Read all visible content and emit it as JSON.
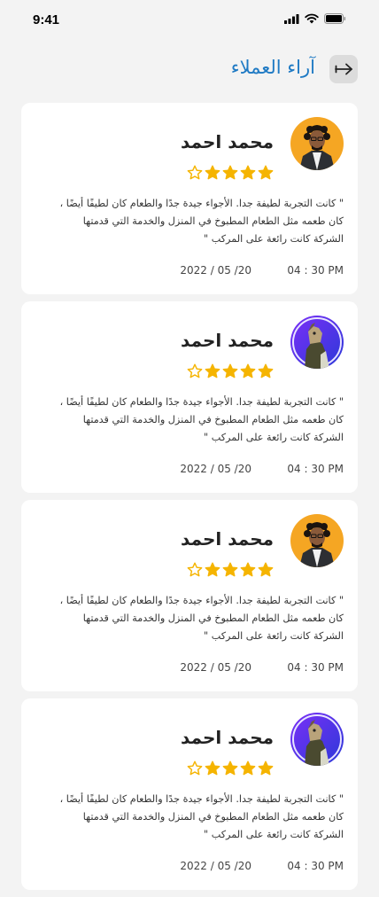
{
  "status_bar": {
    "time": "9:41"
  },
  "header": {
    "title": "آراء العملاء"
  },
  "colors": {
    "accent": "#1f7ac4",
    "star": "#f5b400",
    "background": "#f3f3f3",
    "card": "#ffffff"
  },
  "reviews": [
    {
      "name": "محمد احمد",
      "avatar": "orange-man-avatar",
      "rating": 4,
      "max_rating": 5,
      "text": "\" كانت التجربة لطيفة جدا. الأجواء جيدة جدًا والطعام كان لطيفًا أيضًا ، كان طعمه مثل الطعام المطبوخ في المنزل والخدمة التي قدمتها الشركة كانت رائعة على المركب \"",
      "time": "04 : 30 PM",
      "date": "2022 / 05 /20"
    },
    {
      "name": "محمد احمد",
      "avatar": "purple-horse-avatar",
      "rating": 4,
      "max_rating": 5,
      "text": "\" كانت التجربة لطيفة جدا. الأجواء جيدة جدًا والطعام كان لطيفًا أيضًا ، كان طعمه مثل الطعام المطبوخ في المنزل والخدمة التي قدمتها الشركة كانت رائعة على المركب \"",
      "time": "04 : 30 PM",
      "date": "2022 / 05 /20"
    },
    {
      "name": "محمد احمد",
      "avatar": "orange-man-avatar",
      "rating": 4,
      "max_rating": 5,
      "text": "\" كانت التجربة لطيفة جدا. الأجواء جيدة جدًا والطعام كان لطيفًا أيضًا ، كان طعمه مثل الطعام المطبوخ في المنزل والخدمة التي قدمتها الشركة كانت رائعة على المركب \"",
      "time": "04 : 30 PM",
      "date": "2022 / 05 /20"
    },
    {
      "name": "محمد احمد",
      "avatar": "purple-horse-avatar",
      "rating": 4,
      "max_rating": 5,
      "text": "\" كانت التجربة لطيفة جدا. الأجواء جيدة جدًا والطعام كان لطيفًا أيضًا ، كان طعمه مثل الطعام المطبوخ في المنزل والخدمة التي قدمتها الشركة كانت رائعة على المركب \"",
      "time": "04 : 30 PM",
      "date": "2022 / 05 /20"
    }
  ]
}
